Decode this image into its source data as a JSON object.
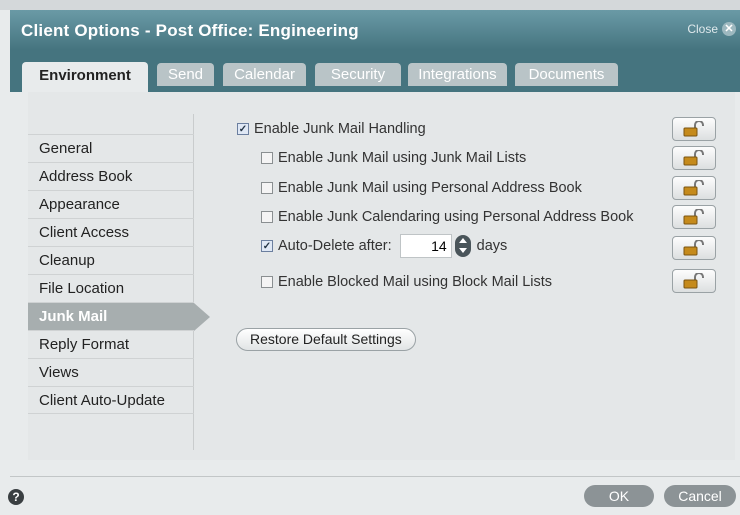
{
  "window": {
    "title": "Client Options - Post Office: Engineering",
    "close_label": "Close",
    "close_icon": "close-icon"
  },
  "tabs": [
    {
      "label": "Environment",
      "active": true
    },
    {
      "label": "Send",
      "active": false
    },
    {
      "label": "Calendar",
      "active": false
    },
    {
      "label": "Security",
      "active": false
    },
    {
      "label": "Integrations",
      "active": false
    },
    {
      "label": "Documents",
      "active": false
    }
  ],
  "sidebar": {
    "items": [
      {
        "label": "General"
      },
      {
        "label": "Address Book"
      },
      {
        "label": "Appearance"
      },
      {
        "label": "Client Access"
      },
      {
        "label": "Cleanup"
      },
      {
        "label": "File Location"
      },
      {
        "label": "Junk Mail",
        "active": true
      },
      {
        "label": "Reply Format"
      },
      {
        "label": "Views"
      },
      {
        "label": "Client Auto-Update"
      }
    ]
  },
  "options": {
    "enable_junk": {
      "label": "Enable Junk Mail Handling",
      "checked": true
    },
    "junk_lists": {
      "label": "Enable Junk Mail using Junk Mail Lists",
      "checked": false
    },
    "junk_pab": {
      "label": "Enable Junk Mail using Personal Address Book",
      "checked": false
    },
    "junk_cal": {
      "label": "Enable Junk Calendaring using Personal Address Book",
      "checked": false
    },
    "auto_delete": {
      "label": "Auto-Delete after:",
      "checked": true,
      "value": "14",
      "unit": "days"
    },
    "blocked": {
      "label": "Enable Blocked Mail using Block Mail Lists",
      "checked": false
    }
  },
  "lock_icon": "unlocked-padlock-icon",
  "restore_label": "Restore Default Settings",
  "footer": {
    "help_icon": "help-icon",
    "help_glyph": "?",
    "ok_label": "OK",
    "cancel_label": "Cancel"
  },
  "colors": {
    "titlebar": "#45747f",
    "active_nav": "#a7aeaf",
    "tab_inactive": "#b9c4c7"
  }
}
